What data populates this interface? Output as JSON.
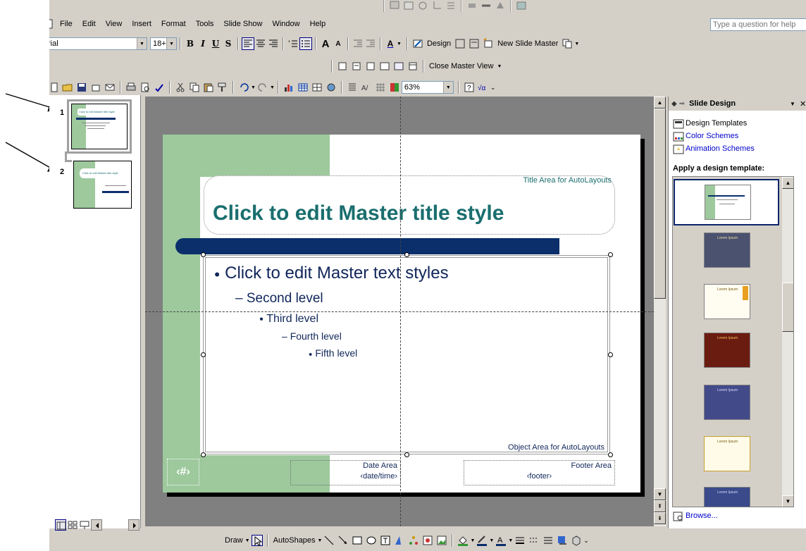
{
  "menu": {
    "file": "File",
    "edit": "Edit",
    "view": "View",
    "insert": "Insert",
    "format": "Format",
    "tools": "Tools",
    "slide_show": "Slide Show",
    "window": "Window",
    "help": "Help"
  },
  "help_box": {
    "placeholder": "Type a question for help"
  },
  "formatting": {
    "font": "rial",
    "size": "18+"
  },
  "master_toolbar": {
    "design": "Design",
    "new_slide_master": "New Slide Master",
    "close_master_view": "Close Master View"
  },
  "standard": {
    "zoom": "63%"
  },
  "thumbnails": [
    {
      "number": "1",
      "title": "Click to edit Master title style"
    },
    {
      "number": "2",
      "title": "Click to edit Master title style"
    }
  ],
  "slide": {
    "title_area_label": "Title Area for AutoLayouts",
    "title": "Click to edit Master title style",
    "levels": [
      "Click to edit Master text styles",
      "Second level",
      "Third level",
      "Fourth level",
      "Fifth level"
    ],
    "object_area_label": "Object Area for AutoLayouts",
    "date_area_label": "Date Area",
    "date_value": "‹date/time›",
    "footer_area_label": "Footer Area",
    "footer_value": "‹footer›",
    "number_value": "‹#›"
  },
  "task_pane": {
    "title": "Slide Design",
    "links": [
      "Design Templates",
      "Color Schemes",
      "Animation Schemes"
    ],
    "apply_heading": "Apply a design template:",
    "browse": "Browse...",
    "template_thumb_text": "Lorem Ipsum"
  },
  "drawing": {
    "draw": "Draw",
    "autoshapes": "AutoShapes"
  },
  "colors": {
    "slide_green": "#9dc99d",
    "title_teal": "#1a6e6e",
    "bar_navy": "#0a2f6b",
    "text_navy": "#10265a",
    "link_blue": "#0000cc"
  }
}
